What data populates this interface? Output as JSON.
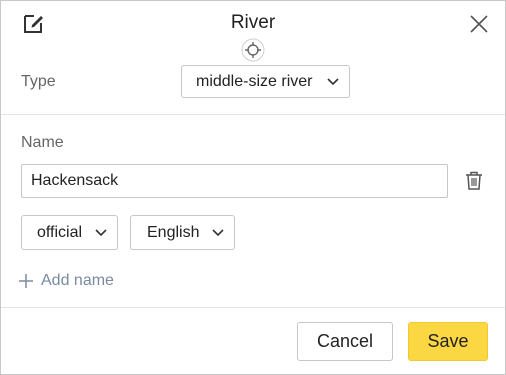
{
  "header": {
    "title": "River",
    "edit_icon": "edit-icon",
    "close_icon": "close-icon",
    "target_icon": "crosshair-icon"
  },
  "type_row": {
    "label": "Type",
    "selected": "middle-size river"
  },
  "names": {
    "label": "Name",
    "value": "Hackensack",
    "status_selected": "official",
    "language_selected": "English",
    "add_label": "Add name"
  },
  "footer": {
    "cancel_label": "Cancel",
    "save_label": "Save"
  },
  "colors": {
    "save_button": "#fbd743",
    "add_link": "#7a8aa0",
    "border": "#c6c6c6"
  }
}
